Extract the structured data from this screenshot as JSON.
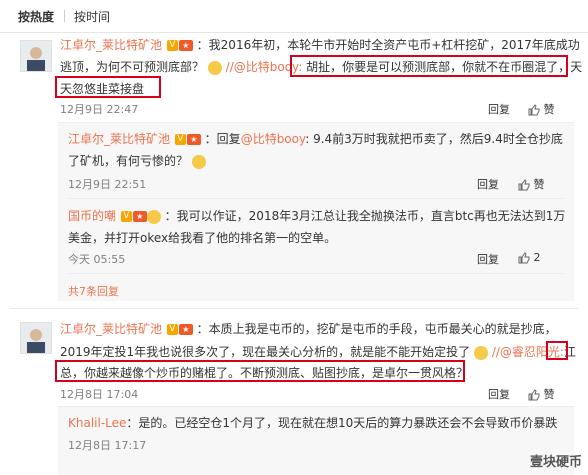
{
  "tabs": {
    "hot": "按热度",
    "time": "按时间"
  },
  "comments": [
    {
      "user": "江卓尔_莱比特矿池",
      "lines": [
        "：我2016年初，本轮牛市开始时全资产屯币+杠杆挖矿，2017年底成功",
        "逃顶，为何不可预测底部？",
        "//@比特booy:",
        "胡扯，你要是可以预测底部，你就不在币圈混了，天",
        "天忽悠韭菜接盘"
      ],
      "time": "12月9日 22:47",
      "reply": "回复",
      "like": "赞",
      "replies": [
        {
          "user": "江卓尔_莱比特矿池",
          "text1": "：回复",
          "mention": "@比特booy",
          "text2": ": 9.4前3万时我就把币卖了，然后9.4时全仓抄底",
          "text3": "了矿机，有何亏惨的？",
          "time": "12月9日 22:51",
          "reply": "回复",
          "like": "赞"
        },
        {
          "user": "国币的嘲",
          "text1": "：我可以作证，2018年3月江总让我全抛换法币，直言btc再也无法达到1万",
          "text2": "美金，并打开okex给我看了他的排名第一的空单。",
          "time": "今天 05:55",
          "reply": "回复",
          "like": "2"
        }
      ],
      "more": "共7条回复"
    },
    {
      "user": "江卓尔_莱比特矿池",
      "lines": [
        "：本质上我是屯币的，挖矿是屯币的手段，屯币最关心的就是抄底，",
        "2019年定投1年我也说很多次了，现在最关心分析的，就是能不能开始定投了",
        "//@睿忍阳光:",
        "江",
        "总，你越来越像个炒币的赌棍了。不断预测底、贴图抄底，是卓尔一贯风格？"
      ],
      "time": "12月8日 17:04",
      "reply": "回复",
      "like": "赞",
      "replies": [
        {
          "user": "Khalil-Lee",
          "text1": "：是的。已经空仓1个月了，现在就在想10天后的算力暴跌还会不会导致币价暴跌",
          "time": "12月8日 17:17"
        }
      ]
    }
  ],
  "watermark": "壹块硬币"
}
